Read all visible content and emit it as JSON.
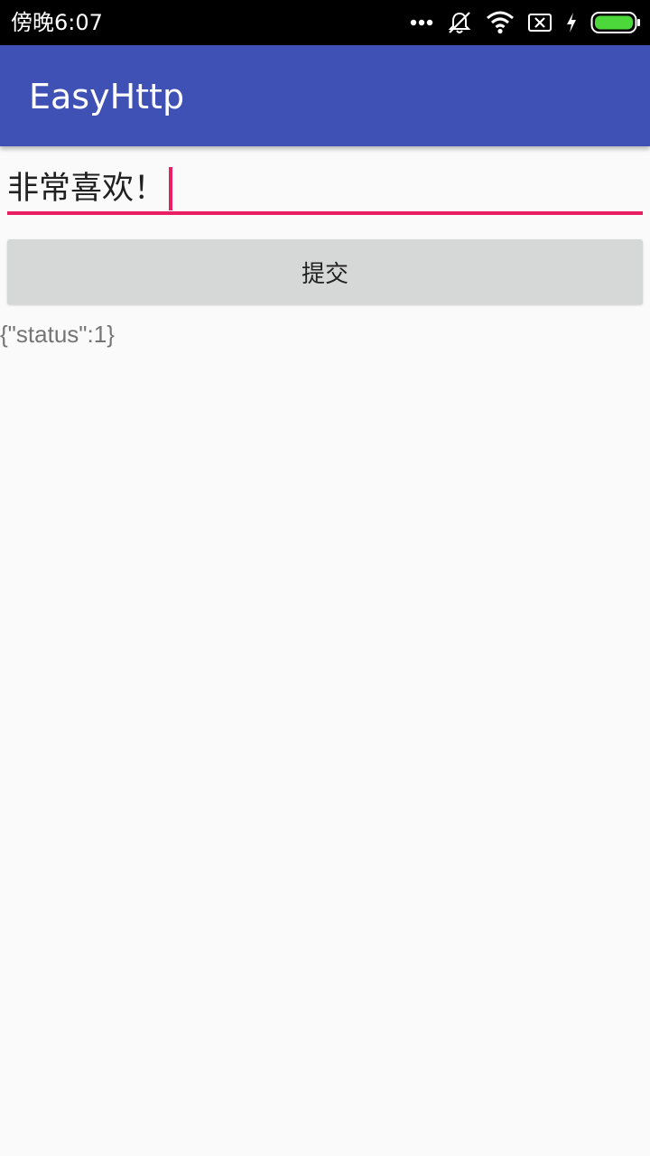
{
  "status_bar": {
    "time": "傍晚6:07",
    "icons": [
      "more-dots-icon",
      "mute-icon",
      "wifi-icon",
      "no-sim-icon",
      "charging-icon",
      "battery-icon"
    ],
    "battery_color": "#4cd83a"
  },
  "app_bar": {
    "title": "EasyHttp",
    "color": "#3f51b5"
  },
  "input": {
    "value": "非常喜欢！",
    "accent_color": "#e91e63"
  },
  "submit_button": {
    "label": "提交"
  },
  "result": {
    "text": "{\"status\":1}"
  }
}
